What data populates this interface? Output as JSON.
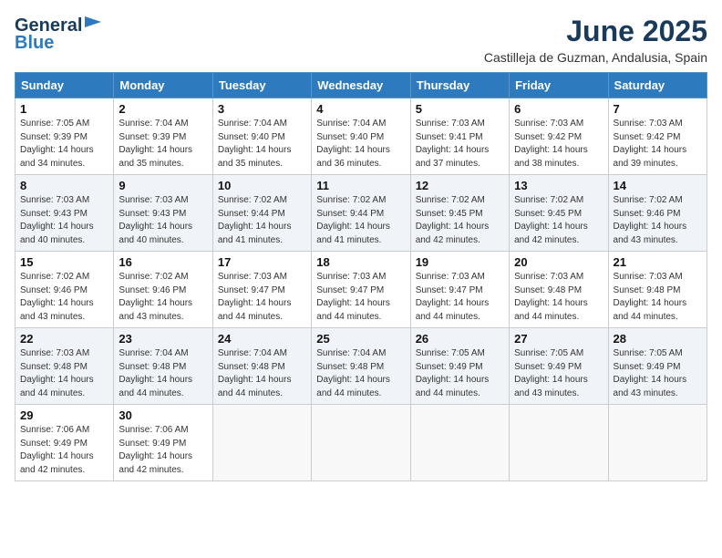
{
  "header": {
    "logo_line1": "General",
    "logo_line2": "Blue",
    "month": "June 2025",
    "location": "Castilleja de Guzman, Andalusia, Spain"
  },
  "weekdays": [
    "Sunday",
    "Monday",
    "Tuesday",
    "Wednesday",
    "Thursday",
    "Friday",
    "Saturday"
  ],
  "weeks": [
    [
      {
        "day": "1",
        "sunrise": "7:05 AM",
        "sunset": "9:39 PM",
        "daylight": "14 hours and 34 minutes."
      },
      {
        "day": "2",
        "sunrise": "7:04 AM",
        "sunset": "9:39 PM",
        "daylight": "14 hours and 35 minutes."
      },
      {
        "day": "3",
        "sunrise": "7:04 AM",
        "sunset": "9:40 PM",
        "daylight": "14 hours and 35 minutes."
      },
      {
        "day": "4",
        "sunrise": "7:04 AM",
        "sunset": "9:40 PM",
        "daylight": "14 hours and 36 minutes."
      },
      {
        "day": "5",
        "sunrise": "7:03 AM",
        "sunset": "9:41 PM",
        "daylight": "14 hours and 37 minutes."
      },
      {
        "day": "6",
        "sunrise": "7:03 AM",
        "sunset": "9:42 PM",
        "daylight": "14 hours and 38 minutes."
      },
      {
        "day": "7",
        "sunrise": "7:03 AM",
        "sunset": "9:42 PM",
        "daylight": "14 hours and 39 minutes."
      }
    ],
    [
      {
        "day": "8",
        "sunrise": "7:03 AM",
        "sunset": "9:43 PM",
        "daylight": "14 hours and 40 minutes."
      },
      {
        "day": "9",
        "sunrise": "7:03 AM",
        "sunset": "9:43 PM",
        "daylight": "14 hours and 40 minutes."
      },
      {
        "day": "10",
        "sunrise": "7:02 AM",
        "sunset": "9:44 PM",
        "daylight": "14 hours and 41 minutes."
      },
      {
        "day": "11",
        "sunrise": "7:02 AM",
        "sunset": "9:44 PM",
        "daylight": "14 hours and 41 minutes."
      },
      {
        "day": "12",
        "sunrise": "7:02 AM",
        "sunset": "9:45 PM",
        "daylight": "14 hours and 42 minutes."
      },
      {
        "day": "13",
        "sunrise": "7:02 AM",
        "sunset": "9:45 PM",
        "daylight": "14 hours and 42 minutes."
      },
      {
        "day": "14",
        "sunrise": "7:02 AM",
        "sunset": "9:46 PM",
        "daylight": "14 hours and 43 minutes."
      }
    ],
    [
      {
        "day": "15",
        "sunrise": "7:02 AM",
        "sunset": "9:46 PM",
        "daylight": "14 hours and 43 minutes."
      },
      {
        "day": "16",
        "sunrise": "7:02 AM",
        "sunset": "9:46 PM",
        "daylight": "14 hours and 43 minutes."
      },
      {
        "day": "17",
        "sunrise": "7:03 AM",
        "sunset": "9:47 PM",
        "daylight": "14 hours and 44 minutes."
      },
      {
        "day": "18",
        "sunrise": "7:03 AM",
        "sunset": "9:47 PM",
        "daylight": "14 hours and 44 minutes."
      },
      {
        "day": "19",
        "sunrise": "7:03 AM",
        "sunset": "9:47 PM",
        "daylight": "14 hours and 44 minutes."
      },
      {
        "day": "20",
        "sunrise": "7:03 AM",
        "sunset": "9:48 PM",
        "daylight": "14 hours and 44 minutes."
      },
      {
        "day": "21",
        "sunrise": "7:03 AM",
        "sunset": "9:48 PM",
        "daylight": "14 hours and 44 minutes."
      }
    ],
    [
      {
        "day": "22",
        "sunrise": "7:03 AM",
        "sunset": "9:48 PM",
        "daylight": "14 hours and 44 minutes."
      },
      {
        "day": "23",
        "sunrise": "7:04 AM",
        "sunset": "9:48 PM",
        "daylight": "14 hours and 44 minutes."
      },
      {
        "day": "24",
        "sunrise": "7:04 AM",
        "sunset": "9:48 PM",
        "daylight": "14 hours and 44 minutes."
      },
      {
        "day": "25",
        "sunrise": "7:04 AM",
        "sunset": "9:48 PM",
        "daylight": "14 hours and 44 minutes."
      },
      {
        "day": "26",
        "sunrise": "7:05 AM",
        "sunset": "9:49 PM",
        "daylight": "14 hours and 44 minutes."
      },
      {
        "day": "27",
        "sunrise": "7:05 AM",
        "sunset": "9:49 PM",
        "daylight": "14 hours and 43 minutes."
      },
      {
        "day": "28",
        "sunrise": "7:05 AM",
        "sunset": "9:49 PM",
        "daylight": "14 hours and 43 minutes."
      }
    ],
    [
      {
        "day": "29",
        "sunrise": "7:06 AM",
        "sunset": "9:49 PM",
        "daylight": "14 hours and 42 minutes."
      },
      {
        "day": "30",
        "sunrise": "7:06 AM",
        "sunset": "9:49 PM",
        "daylight": "14 hours and 42 minutes."
      },
      null,
      null,
      null,
      null,
      null
    ]
  ]
}
